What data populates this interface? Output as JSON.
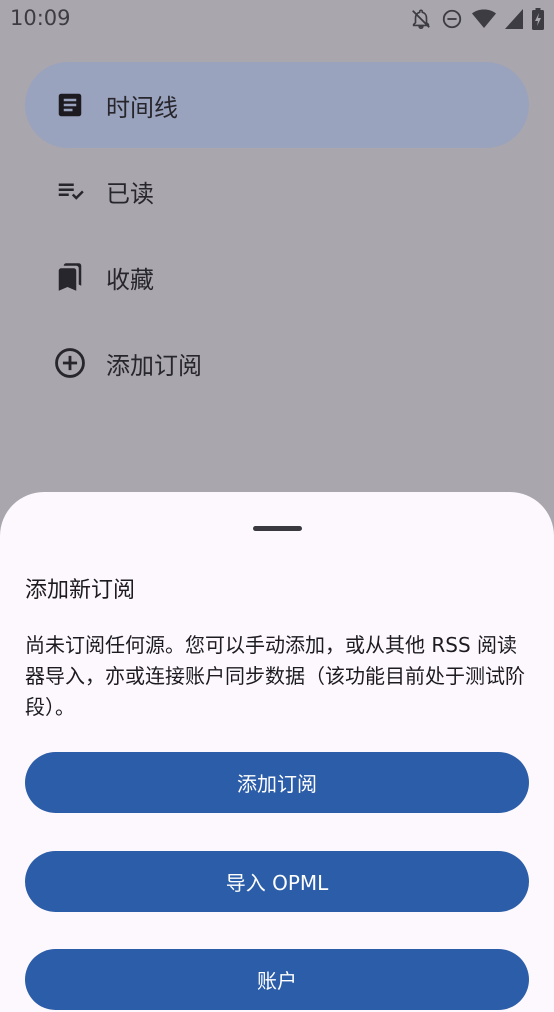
{
  "status_bar": {
    "time": "10:09",
    "icons": [
      "bell-off-icon",
      "do-not-disturb-icon",
      "wifi-icon",
      "signal-icon",
      "battery-charging-icon"
    ]
  },
  "drawer": {
    "items": [
      {
        "label": "时间线",
        "icon": "article-icon",
        "active": true
      },
      {
        "label": "已读",
        "icon": "playlist-check-icon",
        "active": false
      },
      {
        "label": "收藏",
        "icon": "bookmarks-icon",
        "active": false
      },
      {
        "label": "添加订阅",
        "icon": "add-circle-icon",
        "active": false
      }
    ]
  },
  "sheet": {
    "title": "添加新订阅",
    "description": "尚未订阅任何源。您可以手动添加，或从其他 RSS 阅读器导入，亦或连接账户同步数据（该功能目前处于测试阶段）。",
    "buttons": {
      "add": "添加订阅",
      "import": "导入 OPML",
      "account": "账户"
    }
  },
  "colors": {
    "scrim_background": "#a9a6ad",
    "active_item": "#9aa3bd",
    "sheet_background": "#fcf8fe",
    "primary_button": "#2c5da8"
  }
}
